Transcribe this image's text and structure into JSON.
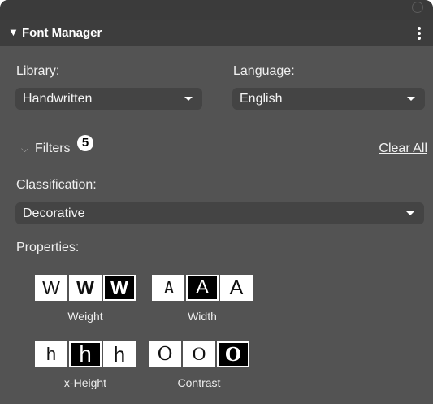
{
  "header": {
    "title": "Font Manager",
    "collapse_glyph": "▼"
  },
  "library": {
    "label": "Library:",
    "value": "Handwritten"
  },
  "language": {
    "label": "Language:",
    "value": "English"
  },
  "filters": {
    "label": "Filters",
    "count": "5",
    "clear_label": "Clear All"
  },
  "classification": {
    "label": "Classification:",
    "value": "Decorative"
  },
  "properties": {
    "label": "Properties:",
    "groups": [
      {
        "caption": "Weight",
        "glyphs": [
          "W",
          "W",
          "W"
        ],
        "selected_index": 2
      },
      {
        "caption": "Width",
        "glyphs": [
          "A",
          "A",
          "A"
        ],
        "selected_index": 1
      },
      {
        "caption": "x-Height",
        "glyphs": [
          "h",
          "h",
          "h"
        ],
        "selected_index": 1
      },
      {
        "caption": "Contrast",
        "glyphs": [
          "O",
          "O",
          "O"
        ],
        "selected_index": 2
      }
    ]
  },
  "colors": {
    "panel_bg": "#535353",
    "header_bg": "#3d3d3d",
    "field_bg": "#444444",
    "selected_swatch": "#000000"
  }
}
